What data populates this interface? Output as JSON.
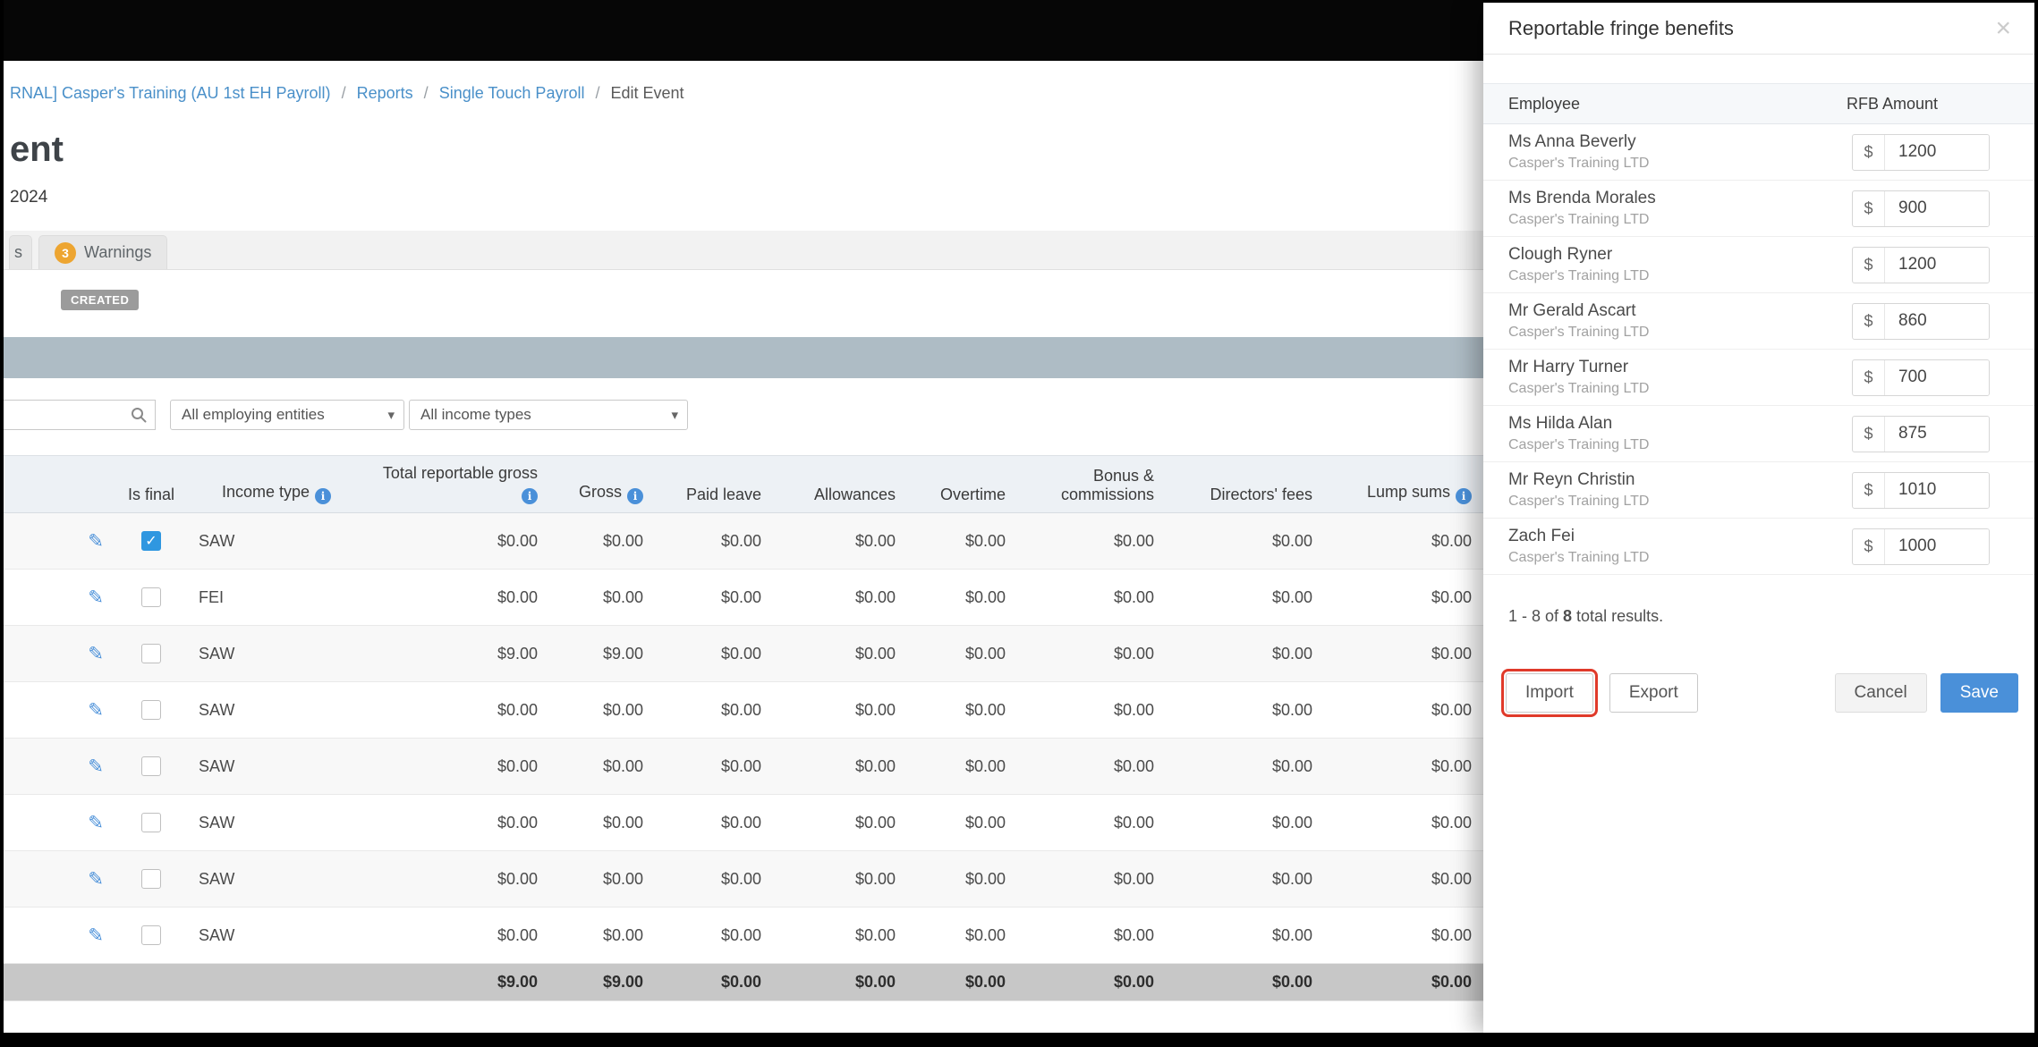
{
  "breadcrumb": {
    "separator": "/",
    "items": [
      {
        "label": "RNAL] Casper's Training (AU 1st EH Payroll)"
      },
      {
        "label": "Reports"
      },
      {
        "label": "Single Touch Payroll"
      },
      {
        "label": "Edit Event"
      }
    ]
  },
  "page": {
    "title_partial": "ent",
    "date_partial": "2024",
    "tab_partial": "s",
    "warnings_tab": {
      "count": "3",
      "label": "Warnings"
    },
    "status_badge": "CREATED"
  },
  "filters": {
    "search_placeholder": "",
    "employing_entities": "All employing entities",
    "income_types": "All income types"
  },
  "table": {
    "headers": {
      "is_final": "Is final",
      "income_type": "Income type",
      "total_reportable_gross": "Total reportable gross",
      "gross": "Gross",
      "paid_leave": "Paid leave",
      "allowances": "Allowances",
      "overtime": "Overtime",
      "bonus_commissions": "Bonus & commissions",
      "directors_fees": "Directors' fees",
      "lump_sums": "Lump sums"
    },
    "rows": [
      {
        "is_final": true,
        "income_type": "SAW",
        "values": [
          "$0.00",
          "$0.00",
          "$0.00",
          "$0.00",
          "$0.00",
          "$0.00",
          "$0.00",
          "$0.00"
        ]
      },
      {
        "is_final": false,
        "income_type": "FEI",
        "values": [
          "$0.00",
          "$0.00",
          "$0.00",
          "$0.00",
          "$0.00",
          "$0.00",
          "$0.00",
          "$0.00"
        ]
      },
      {
        "is_final": false,
        "income_type": "SAW",
        "values": [
          "$9.00",
          "$9.00",
          "$0.00",
          "$0.00",
          "$0.00",
          "$0.00",
          "$0.00",
          "$0.00"
        ]
      },
      {
        "is_final": false,
        "income_type": "SAW",
        "values": [
          "$0.00",
          "$0.00",
          "$0.00",
          "$0.00",
          "$0.00",
          "$0.00",
          "$0.00",
          "$0.00"
        ]
      },
      {
        "is_final": false,
        "income_type": "SAW",
        "values": [
          "$0.00",
          "$0.00",
          "$0.00",
          "$0.00",
          "$0.00",
          "$0.00",
          "$0.00",
          "$0.00"
        ]
      },
      {
        "is_final": false,
        "income_type": "SAW",
        "values": [
          "$0.00",
          "$0.00",
          "$0.00",
          "$0.00",
          "$0.00",
          "$0.00",
          "$0.00",
          "$0.00"
        ]
      },
      {
        "is_final": false,
        "income_type": "SAW",
        "values": [
          "$0.00",
          "$0.00",
          "$0.00",
          "$0.00",
          "$0.00",
          "$0.00",
          "$0.00",
          "$0.00"
        ]
      },
      {
        "is_final": false,
        "income_type": "SAW",
        "values": [
          "$0.00",
          "$0.00",
          "$0.00",
          "$0.00",
          "$0.00",
          "$0.00",
          "$0.00",
          "$0.00"
        ]
      }
    ],
    "totals": [
      "$9.00",
      "$9.00",
      "$0.00",
      "$0.00",
      "$0.00",
      "$0.00",
      "$0.00",
      "$0.00"
    ]
  },
  "modal": {
    "title": "Reportable fringe benefits",
    "columns": {
      "employee": "Employee",
      "amount": "RFB Amount"
    },
    "currency": "$",
    "rows": [
      {
        "name": "Ms Anna Beverly",
        "company": "Casper's Training LTD",
        "amount": "1200"
      },
      {
        "name": "Ms Brenda Morales",
        "company": "Casper's Training LTD",
        "amount": "900"
      },
      {
        "name": "Clough Ryner",
        "company": "Casper's Training LTD",
        "amount": "1200"
      },
      {
        "name": "Mr Gerald Ascart",
        "company": "Casper's Training LTD",
        "amount": "860"
      },
      {
        "name": "Mr Harry Turner",
        "company": "Casper's Training LTD",
        "amount": "700"
      },
      {
        "name": "Ms Hilda Alan",
        "company": "Casper's Training LTD",
        "amount": "875"
      },
      {
        "name": "Mr Reyn Christin",
        "company": "Casper's Training LTD",
        "amount": "1010"
      },
      {
        "name": "Zach Fei",
        "company": "Casper's Training LTD",
        "amount": "1000"
      }
    ],
    "results": {
      "prefix": "1 - 8 of ",
      "total": "8",
      "suffix": " total results."
    },
    "buttons": {
      "import": "Import",
      "export": "Export",
      "cancel": "Cancel",
      "save": "Save"
    }
  }
}
